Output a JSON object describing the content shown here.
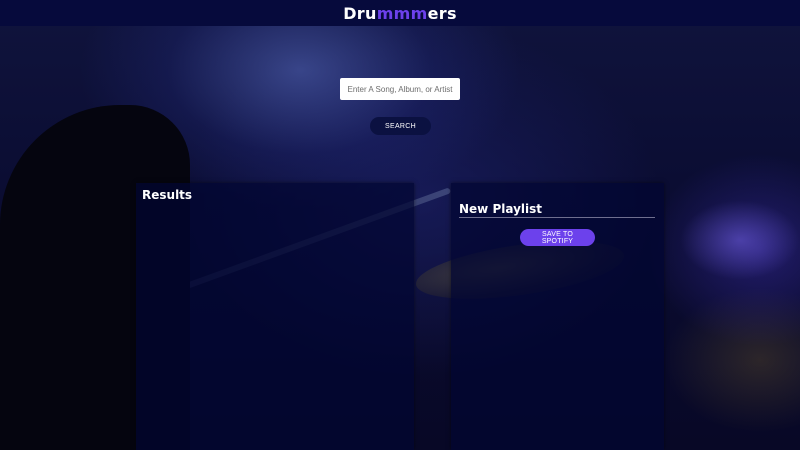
{
  "header": {
    "logo_prefix": "Dru",
    "logo_accent": "mmm",
    "logo_suffix": "ers"
  },
  "search": {
    "placeholder": "Enter A Song, Album, or Artist",
    "value": "",
    "button_label": "SEARCH"
  },
  "results": {
    "title": "Results",
    "tracks": []
  },
  "playlist": {
    "title": "New Playlist",
    "save_label": "SAVE TO SPOTIFY",
    "tracks": []
  },
  "colors": {
    "header_bg": "#060a3c",
    "accent": "#6c41ec",
    "panel_bg": "#02063280",
    "search_button_bg": "#0b1141"
  }
}
